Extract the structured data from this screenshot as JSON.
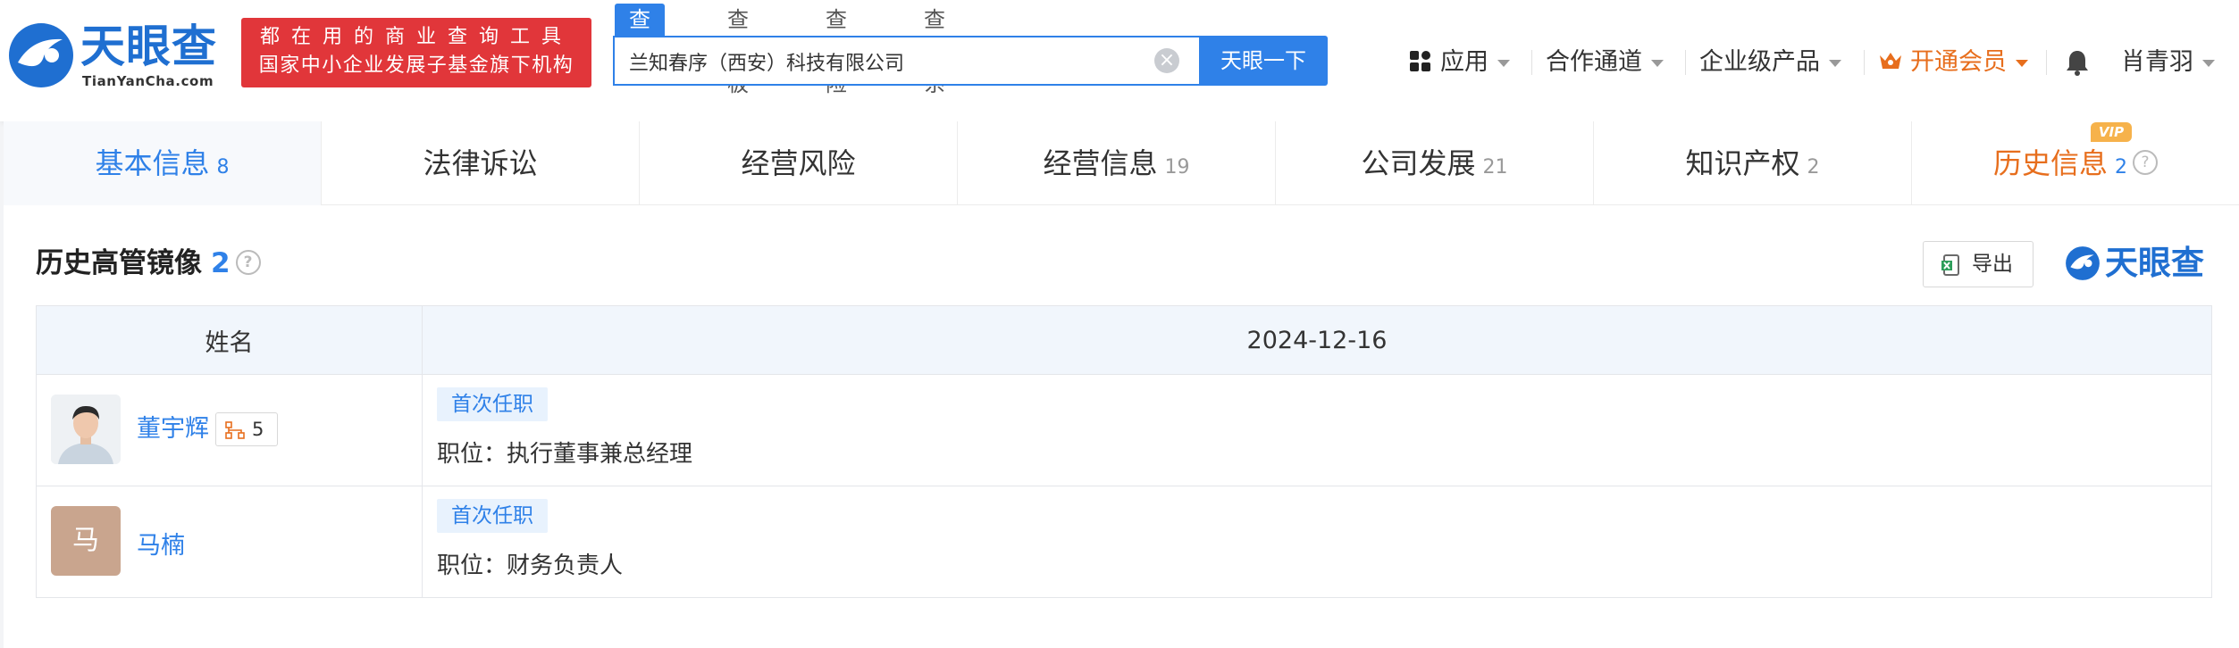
{
  "brand": {
    "name": "天眼查",
    "domain": "TianYanCha.com",
    "slogan_line1": "都在用的商业查询工具",
    "slogan_line2": "国家中小企业发展子基金旗下机构",
    "color": "#1f6fd1"
  },
  "search": {
    "tabs": [
      "查公司",
      "查老板",
      "查风险",
      "查关系"
    ],
    "active_tab": "查公司",
    "value": "兰知春序（西安）科技有限公司",
    "button": "天眼一下"
  },
  "nav": {
    "apps": "应用",
    "partner": "合作通道",
    "enterprise": "企业级产品",
    "vip": "开通会员",
    "user": "肖青羽"
  },
  "tabs": [
    {
      "label": "基本信息",
      "count": "8"
    },
    {
      "label": "法律诉讼",
      "count": ""
    },
    {
      "label": "经营风险",
      "count": ""
    },
    {
      "label": "经营信息",
      "count": "19"
    },
    {
      "label": "公司发展",
      "count": "21"
    },
    {
      "label": "知识产权",
      "count": "2"
    },
    {
      "label": "历史信息",
      "count": "2",
      "badge": "VIP"
    }
  ],
  "section": {
    "title": "历史高管镜像",
    "count": "2",
    "export": "导出",
    "watermark": "天眼查"
  },
  "table": {
    "headers": [
      "姓名",
      "2024-12-16"
    ],
    "rows": [
      {
        "name": "董宇辉",
        "relations": "5",
        "tag": "首次任职",
        "position": "职位：执行董事兼总经理",
        "avatar": "photo"
      },
      {
        "name": "马楠",
        "relations": "",
        "tag": "首次任职",
        "position": "职位：财务负责人",
        "avatar": "马"
      }
    ]
  },
  "colors": {
    "accent": "#2f81e8",
    "vip": "#e76e1d",
    "slogan_bg": "#e1363a"
  }
}
